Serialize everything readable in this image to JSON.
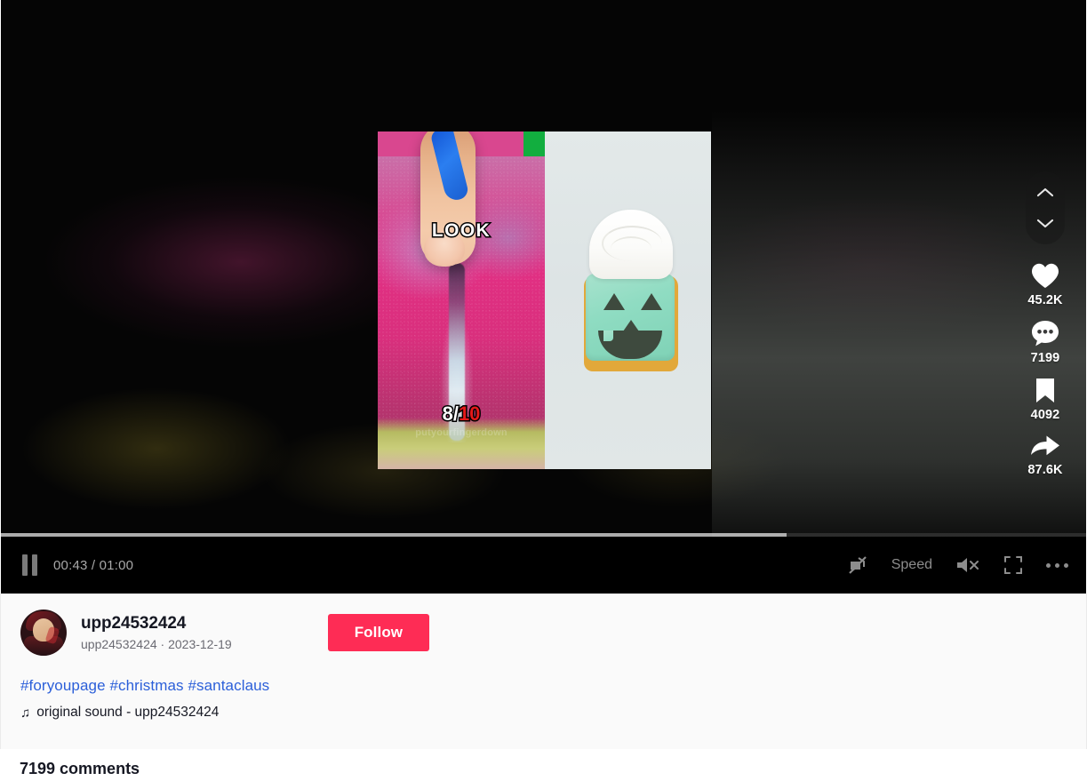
{
  "player": {
    "time_current": "00:43",
    "time_total": "01:00",
    "time_display": "00:43 / 01:00",
    "progress_percent": 72.3,
    "pause_icon": "pause-icon",
    "controls": {
      "captions_off_label": "captions-off-icon",
      "speed_label": "Speed",
      "volume_muted_label": "volume-muted-icon",
      "fullscreen_label": "fullscreen-icon",
      "more_label": "more-options-icon"
    },
    "navigation": {
      "previous_label": "chevron-up-icon",
      "next_label": "chevron-down-icon"
    }
  },
  "video_overlay": {
    "left_panel": {
      "caption": "LOOK",
      "rating_numerator": "8/",
      "rating_denominator": "10",
      "watermark": "putyourfingerdown"
    }
  },
  "actions": [
    {
      "name": "like",
      "icon": "heart-icon",
      "count": "45.2K"
    },
    {
      "name": "comment",
      "icon": "comment-icon",
      "count": "7199"
    },
    {
      "name": "bookmark",
      "icon": "bookmark-icon",
      "count": "4092"
    },
    {
      "name": "share",
      "icon": "share-icon",
      "count": "87.6K"
    }
  ],
  "author": {
    "display_name": "upp24532424",
    "meta": "upp24532424 · 2023-12-19",
    "username": "upp24532424",
    "date": "2023-12-19",
    "follow_label": "Follow",
    "avatar_label": "user-avatar"
  },
  "post": {
    "hashtags": [
      "#foryoupage",
      "#christmas",
      "#santaclaus"
    ],
    "hashtags_text": "#foryoupage #christmas #santaclaus",
    "music_note": "♫",
    "music_label": "original sound - upp24532424"
  },
  "comments": {
    "header": "7199 comments",
    "count": "7199"
  },
  "colors": {
    "brand_red": "#fe2c55",
    "link_blue": "#2b5fd9",
    "text_primary": "#161823",
    "text_secondary": "#6b6b73",
    "panel_bg": "#fafafa",
    "player_bg": "#000000"
  }
}
